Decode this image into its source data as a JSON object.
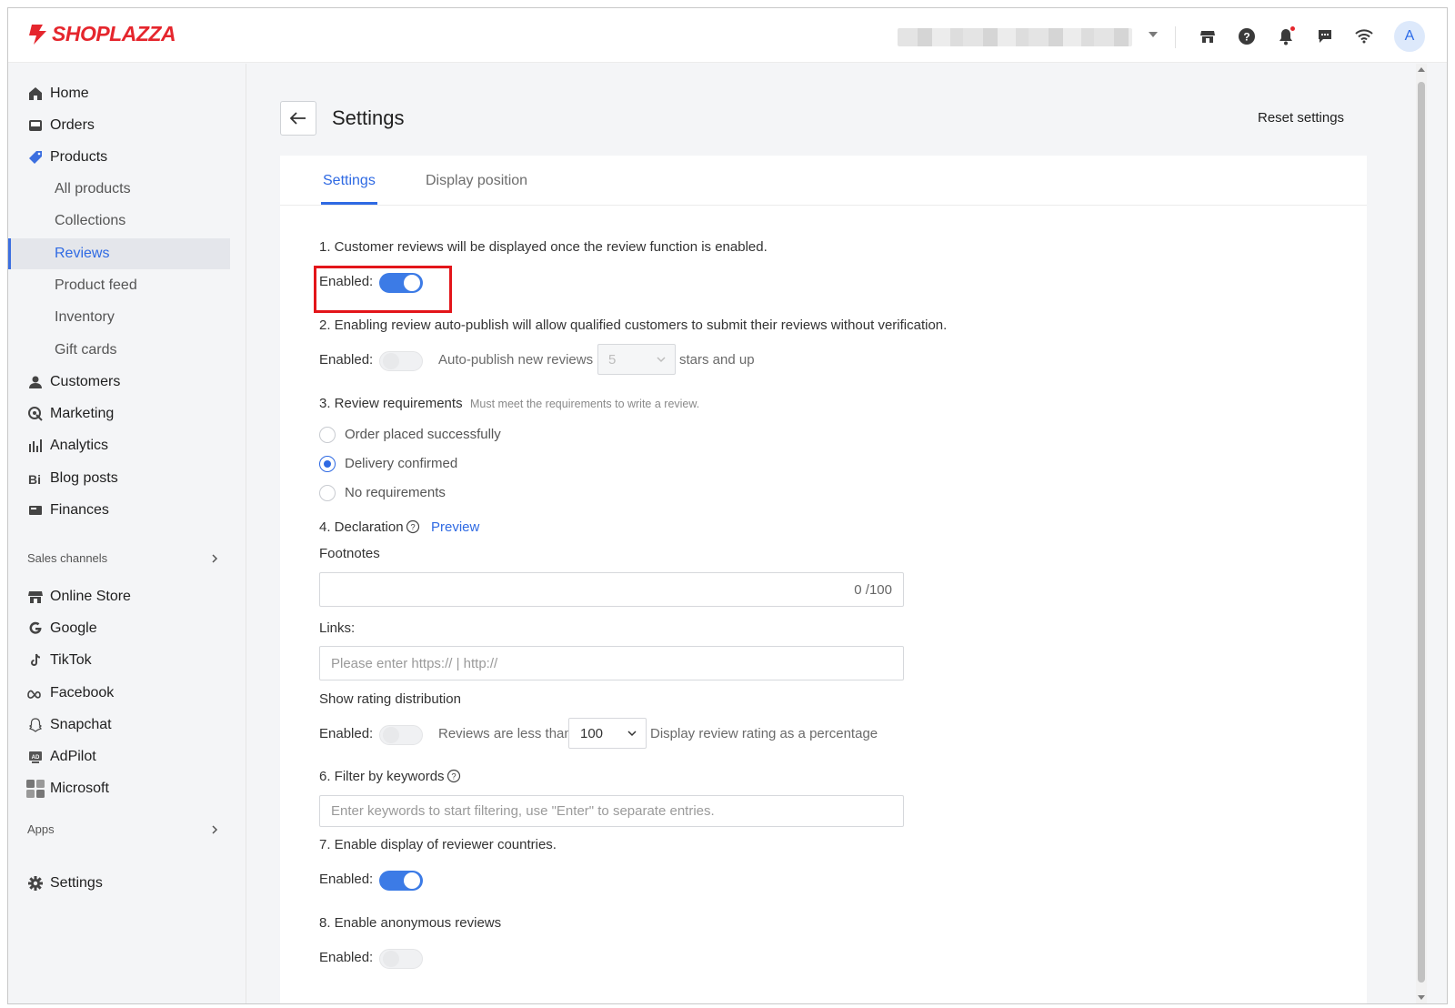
{
  "brand": {
    "name": "SHOPLAZZA",
    "color": "#e5262d"
  },
  "topbar": {
    "icons": [
      "store-icon",
      "help-icon",
      "bell-icon",
      "message-icon",
      "wifi-icon"
    ],
    "avatar_letter": "A"
  },
  "sidebar": {
    "items": [
      {
        "label": "Home",
        "icon": "home-icon"
      },
      {
        "label": "Orders",
        "icon": "orders-icon"
      },
      {
        "label": "Products",
        "icon": "tag-icon"
      },
      {
        "label": "Customers",
        "icon": "person-icon"
      },
      {
        "label": "Marketing",
        "icon": "marketing-icon"
      },
      {
        "label": "Analytics",
        "icon": "bar-chart-icon"
      },
      {
        "label": "Blog posts",
        "icon": "blog-icon"
      },
      {
        "label": "Finances",
        "icon": "finance-icon"
      }
    ],
    "products_sub": [
      "All products",
      "Collections",
      "Reviews",
      "Product feed",
      "Inventory",
      "Gift cards"
    ],
    "active_sub": "Reviews",
    "sales_channels_title": "Sales channels",
    "channels": [
      {
        "label": "Online Store",
        "icon": "store-icon"
      },
      {
        "label": "Google",
        "icon": "google-icon"
      },
      {
        "label": "TikTok",
        "icon": "tiktok-icon"
      },
      {
        "label": "Facebook",
        "icon": "meta-icon"
      },
      {
        "label": "Snapchat",
        "icon": "snapchat-icon"
      },
      {
        "label": "AdPilot",
        "icon": "adpilot-icon"
      },
      {
        "label": "Microsoft",
        "icon": "microsoft-icon"
      }
    ],
    "apps_title": "Apps",
    "settings_label": "Settings"
  },
  "header": {
    "title": "Settings",
    "reset_label": "Reset settings"
  },
  "tabs": [
    {
      "label": "Settings",
      "active": true
    },
    {
      "label": "Display position",
      "active": false
    }
  ],
  "form": {
    "enabled_label": "Enabled:",
    "s1": {
      "text": "1. Customer reviews will be displayed once the review function is enabled.",
      "enabled": true
    },
    "s2": {
      "text": "2. Enabling review auto-publish will allow qualified customers to submit their reviews without verification.",
      "enabled": false,
      "auto_label": "Auto-publish new reviews",
      "stars_value": "5",
      "suffix": "stars and up"
    },
    "s3": {
      "text": "3. Review requirements",
      "hint": "Must meet the requirements to write a review.",
      "options": [
        "Order placed successfully",
        "Delivery confirmed",
        "No requirements"
      ],
      "selected": "Delivery confirmed"
    },
    "s4": {
      "text": "4. Declaration",
      "preview_label": "Preview",
      "footnotes_label": "Footnotes",
      "footnotes_count": "0 /100",
      "links_label": "Links:",
      "links_placeholder": "Please enter https:// | http://"
    },
    "s5": {
      "text": "Show rating distribution",
      "enabled": false,
      "less_than_label": "Reviews are less than",
      "value": "100",
      "suffix": "Display review rating as a percentage"
    },
    "s6": {
      "text": "6. Filter by keywords",
      "placeholder": "Enter keywords to start filtering, use \"Enter\" to separate entries."
    },
    "s7": {
      "text": "7. Enable display of reviewer countries.",
      "enabled": true
    },
    "s8": {
      "text": "8. Enable anonymous reviews",
      "enabled": false
    }
  },
  "colors": {
    "accent": "#2f6ae3",
    "toggle_on": "#3c7be6",
    "highlight": "#e3151a"
  }
}
